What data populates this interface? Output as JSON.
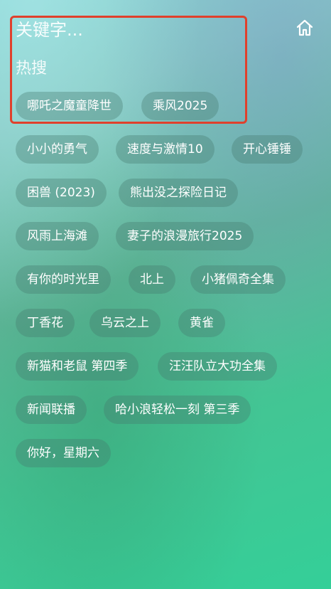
{
  "search": {
    "placeholder": "关键字..."
  },
  "header": {
    "home_icon": "home-icon"
  },
  "hot_section": {
    "title": "热搜"
  },
  "colors": {
    "highlight_border": "#e0402c",
    "tag_background": "rgba(70,120,110,0.35)",
    "text": "#ffffff"
  },
  "tags": [
    "哪吒之魔童降世",
    "乘风2025",
    "小小的勇气",
    "速度与激情10",
    "开心锤锤",
    "困兽 (2023)",
    "熊出没之探险日记",
    "风雨上海滩",
    "妻子的浪漫旅行2025",
    "有你的时光里",
    "北上",
    "小猪佩奇全集",
    "丁香花",
    "乌云之上",
    "黄雀",
    "新猫和老鼠 第四季",
    "汪汪队立大功全集",
    "新闻联播",
    "哈小浪轻松一刻 第三季",
    "你好，星期六"
  ]
}
